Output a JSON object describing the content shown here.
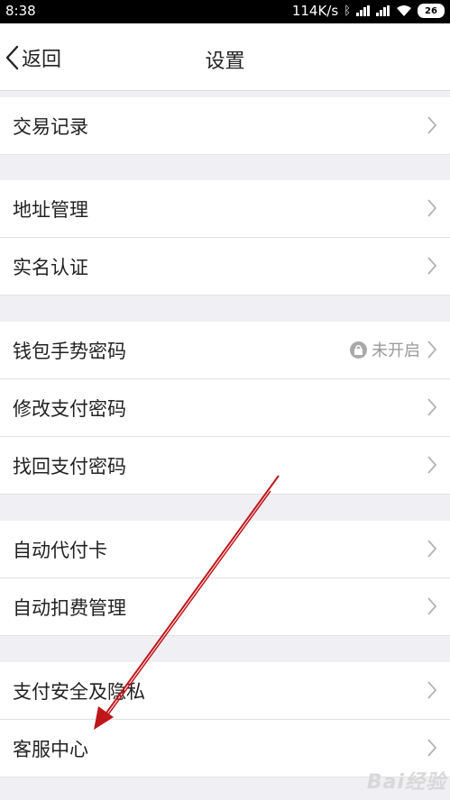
{
  "status_bar": {
    "time": "8:38",
    "net_speed": "114K/s",
    "battery": "26"
  },
  "header": {
    "back_label": "返回",
    "title": "设置"
  },
  "rows": {
    "transaction_records": "交易记录",
    "address_management": "地址管理",
    "real_name_auth": "实名认证",
    "wallet_gesture_password": "钱包手势密码",
    "wallet_gesture_status": "未开启",
    "change_pay_password": "修改支付密码",
    "recover_pay_password": "找回支付密码",
    "auto_pay_card": "自动代付卡",
    "auto_deduction": "自动扣费管理",
    "payment_security_privacy": "支付安全及隐私",
    "customer_service": "客服中心"
  },
  "watermark": {
    "text": "Bai经验"
  },
  "colors": {
    "annotation_arrow": "#c0151a",
    "chevron": "#b3b3b3",
    "background": "#efeff4"
  }
}
